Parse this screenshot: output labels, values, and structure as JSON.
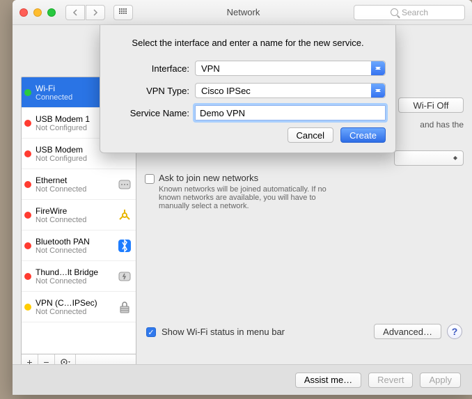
{
  "window": {
    "title": "Network",
    "search_placeholder": "Search"
  },
  "sidebar": {
    "items": [
      {
        "name": "Wi-Fi",
        "status": "Connected",
        "dot": "#29c940"
      },
      {
        "name": "USB Modem 1",
        "status": "Not Configured",
        "dot": "#ff3b30"
      },
      {
        "name": "USB Modem",
        "status": "Not Configured",
        "dot": "#ff3b30"
      },
      {
        "name": "Ethernet",
        "status": "Not Connected",
        "dot": "#ff3b30"
      },
      {
        "name": "FireWire",
        "status": "Not Connected",
        "dot": "#ff3b30"
      },
      {
        "name": "Bluetooth PAN",
        "status": "Not Connected",
        "dot": "#ff3b30"
      },
      {
        "name": "Thund…lt Bridge",
        "status": "Not Connected",
        "dot": "#ff3b30"
      },
      {
        "name": "VPN (C…IPSec)",
        "status": "Not Connected",
        "dot": "#ffcc00"
      }
    ]
  },
  "main": {
    "wifi_off_btn": "Wi-Fi Off",
    "status_tail": "and has the",
    "ask_join_label": "Ask to join new networks",
    "ask_join_help": "Known networks will be joined automatically. If no known networks are available, you will have to manually select a network.",
    "show_status_label": "Show Wi-Fi status in menu bar",
    "advanced_btn": "Advanced…"
  },
  "footer": {
    "assist": "Assist me…",
    "revert": "Revert",
    "apply": "Apply"
  },
  "sheet": {
    "heading": "Select the interface and enter a name for the new service.",
    "interface_label": "Interface:",
    "vpntype_label": "VPN Type:",
    "name_label": "Service Name:",
    "interface_value": "VPN",
    "vpntype_value": "Cisco IPSec",
    "name_value": "Demo VPN",
    "cancel": "Cancel",
    "create": "Create"
  }
}
